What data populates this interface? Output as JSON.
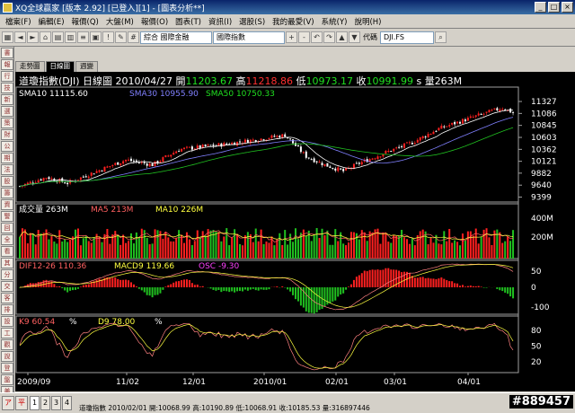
{
  "window": {
    "title": "XQ全球贏家 [版本 2.92] [已登入][1] - [圖表分析**]",
    "buttons": [
      "_",
      "□",
      "×"
    ]
  },
  "menu": [
    "檔案(F)",
    "編輯(E)",
    "報價(Q)",
    "大盤(M)",
    "報價(O)",
    "圖表(T)",
    "資訊(I)",
    "選股(S)",
    "我的最愛(V)",
    "系統(Y)",
    "說明(H)"
  ],
  "toolbar": {
    "select1": "綜合 國際金融",
    "select2": "國際指數",
    "code_label": "代碼",
    "code_value": "DJI.FS"
  },
  "left_tabs": [
    "書",
    "報",
    "行",
    "技",
    "新",
    "選",
    "策",
    "財",
    "公",
    "期",
    "法",
    "股",
    "籌",
    "資",
    "警",
    "回",
    "全",
    "看",
    "其",
    "分",
    "交",
    "客",
    "排",
    "設",
    "工",
    "觀",
    "說",
    "登",
    "盤",
    "美"
  ],
  "tabs": [
    "走勢圖",
    "日線圖",
    "週變"
  ],
  "info": {
    "name": "道瓊指數(DJI)",
    "period": "日線圖",
    "date": "2010/04/27",
    "open_label": "開",
    "open": "11203.67",
    "high_label": "高",
    "high": "11218.86",
    "low_label": "低",
    "low": "10973.17",
    "close_label": "收",
    "close": "10991.99",
    "close_suffix": "s",
    "vol_label": "量",
    "vol": "263M"
  },
  "price_legend": {
    "sma10": "SMA10 11115.60",
    "sma30": "SMA30 10955.90",
    "sma50": "SMA50 10750.33"
  },
  "vol_legend": {
    "vol": "成交量 263M",
    "ma5": "MA5 213M",
    "ma10": "MA10 226M"
  },
  "macd_legend": {
    "dif": "DIF12-26 110.36",
    "macd": "MACD9 119.66",
    "osc": "OSC -9.30"
  },
  "kd_legend": {
    "k": "K9 60.54",
    "k_suffix": "%",
    "d": "D9 78.00",
    "d_suffix": "%"
  },
  "price_axis": [
    "11327",
    "11086",
    "10845",
    "10603",
    "10362",
    "10121",
    "9882",
    "9640",
    "9399"
  ],
  "vol_axis": [
    "400M",
    "200M"
  ],
  "macd_axis": [
    "50",
    "0",
    "-100"
  ],
  "kd_axis": [
    "80",
    "50",
    "20"
  ],
  "date_axis": [
    "2009/09",
    "11/02",
    "12/01",
    "2010/01",
    "02/01",
    "03/01",
    "04/01"
  ],
  "bottom": {
    "page_tabs": [
      "1",
      "2",
      "3",
      "4"
    ],
    "status": "道瓊指數 2010/02/01 開:10068.99 高:10190.89 低:10068.91 收:10185.53 量:316897446",
    "watermark": "#889457"
  },
  "colors": {
    "up": "#ff2020",
    "down": "#ffffff",
    "sma10": "#ffffff",
    "sma30": "#8080ff",
    "sma50": "#20c020",
    "grid": "#404040"
  },
  "chart_data": {
    "type": "candlestick",
    "series_hint": "DJI daily OHLC 2009/09 - 2010/04/27",
    "ylim": [
      9399,
      11327
    ]
  }
}
